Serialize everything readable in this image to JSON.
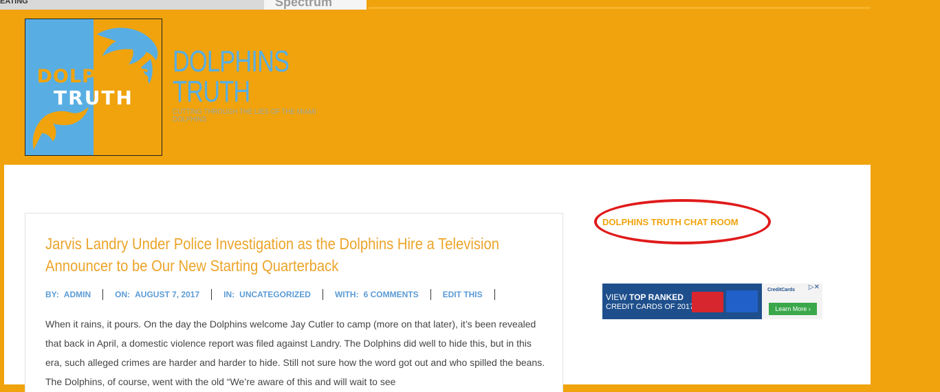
{
  "top_strip": {
    "left_text": "EATING",
    "right_text": "Spectrum"
  },
  "site": {
    "logo_line1": "DOLPHINS",
    "logo_line2": "TRUTH",
    "title_line1": "DOLPHINS",
    "title_line2": "TRUTH",
    "tagline": "CUTTING THROUGH THE LIES OF THE MIAMI DOLPHINS"
  },
  "post": {
    "title": "Jarvis Landry Under Police Investigation as the Dolphins Hire a Television Announcer to be Our New Starting Quarterback",
    "meta": {
      "by_label": "BY:",
      "by_value": "ADMIN",
      "on_label": "ON:",
      "on_value": "AUGUST 7, 2017",
      "in_label": "IN:",
      "in_value": "UNCATEGORIZED",
      "with_label": "WITH:",
      "with_value": "6 COMMENTS",
      "edit": "EDIT THIS"
    },
    "body": "When it rains, it pours. On the day the Dolphins welcome Jay Cutler to camp (more on that later), it’s been revealed that back in April, a domestic violence report was filed against Landry.   The Dolphins did well to hide this, but in this era, such alleged crimes are harder and harder to hide.   Still not sure how the word got out and who spilled the beans.  The Dolphins, of course, went with the old “We’re aware of this and will wait to see"
  },
  "sidebar": {
    "chat_link": "DOLPHINS TRUTH CHAT ROOM",
    "ad": {
      "line1_prefix": "VIEW ",
      "line1_bold": "TOP RANKED",
      "line2": "CREDIT CARDS OF 2017",
      "brand": "CreditCards",
      "button": "Learn More ›",
      "adchoice": "▷✕"
    }
  },
  "colors": {
    "background": "#f0a30d",
    "accent_blue": "#58aee3",
    "link_orange": "#f0a30d",
    "ellipse_red": "#e01b1b"
  }
}
